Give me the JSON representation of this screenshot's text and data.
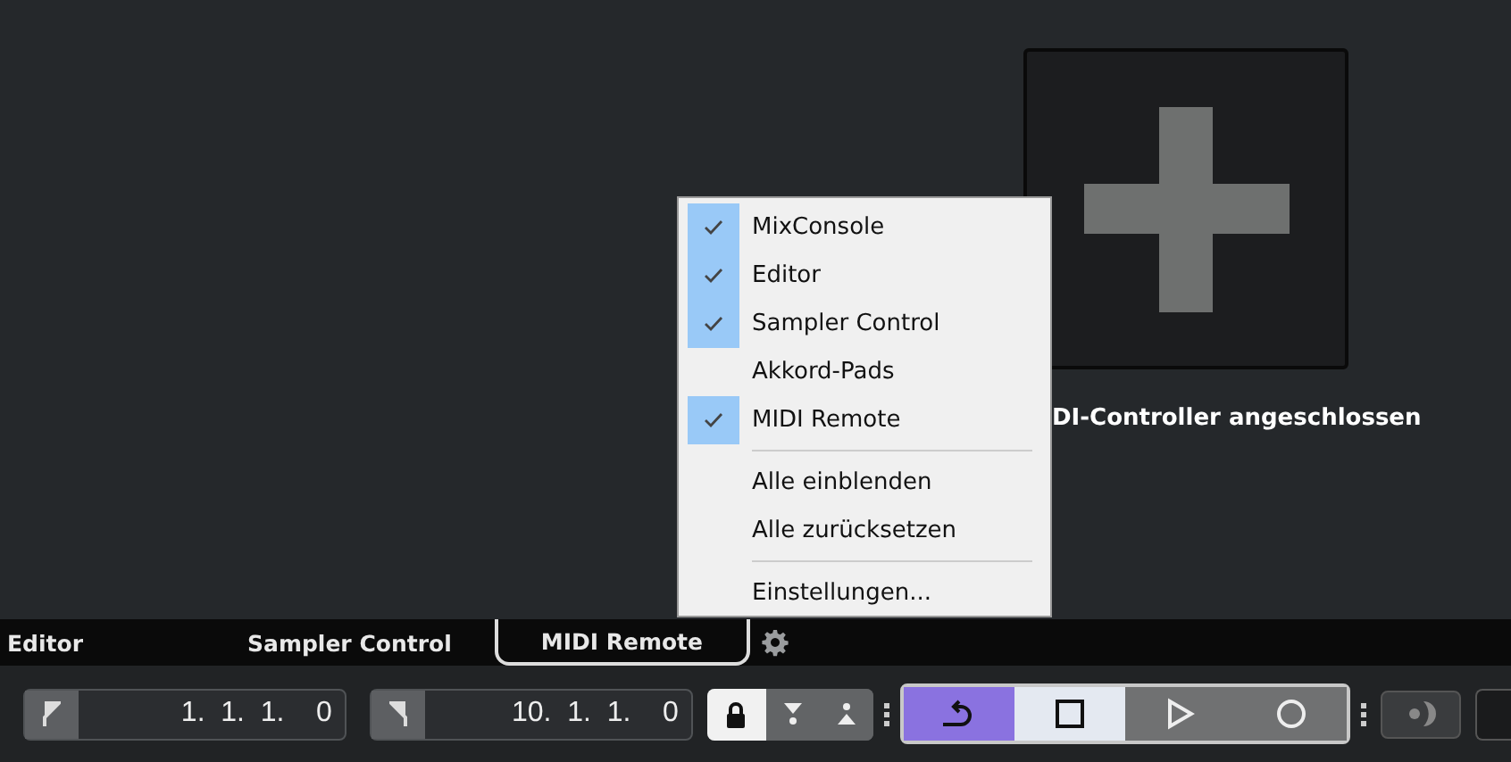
{
  "panel": {
    "message": "DI-Controller angeschlossen"
  },
  "menu": {
    "items": [
      {
        "kind": "toggle",
        "label": "MixConsole",
        "checked": true
      },
      {
        "kind": "toggle",
        "label": "Editor",
        "checked": true
      },
      {
        "kind": "toggle",
        "label": "Sampler Control",
        "checked": true
      },
      {
        "kind": "toggle",
        "label": "Akkord-Pads",
        "checked": false
      },
      {
        "kind": "toggle",
        "label": "MIDI Remote",
        "checked": true
      },
      {
        "kind": "separator"
      },
      {
        "kind": "action",
        "label": "Alle einblenden"
      },
      {
        "kind": "action",
        "label": "Alle zurücksetzen"
      },
      {
        "kind": "separator"
      },
      {
        "kind": "action",
        "label": "Einstellungen..."
      }
    ]
  },
  "tabs": [
    {
      "label": "Editor",
      "selected": false
    },
    {
      "label": "Sampler Control",
      "selected": false
    },
    {
      "label": "MIDI Remote",
      "selected": true
    }
  ],
  "transport": {
    "left_locator": "1.  1.  1.    0",
    "right_locator": "10.  1.  1.    0",
    "lock_on": true,
    "buttons": [
      {
        "kind": "cycle",
        "on": true
      },
      {
        "kind": "stop",
        "on": true
      },
      {
        "kind": "play",
        "on": false
      },
      {
        "kind": "record",
        "on": false
      }
    ]
  }
}
